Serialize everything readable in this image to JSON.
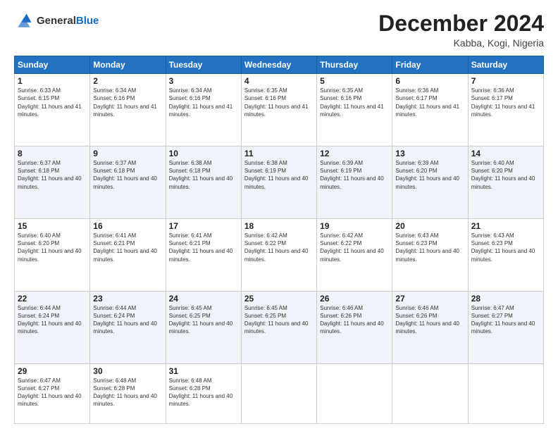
{
  "header": {
    "logo_general": "General",
    "logo_blue": "Blue",
    "month_title": "December 2024",
    "location": "Kabba, Kogi, Nigeria"
  },
  "weekdays": [
    "Sunday",
    "Monday",
    "Tuesday",
    "Wednesday",
    "Thursday",
    "Friday",
    "Saturday"
  ],
  "weeks": [
    [
      {
        "day": 1,
        "sunrise": "6:33 AM",
        "sunset": "6:15 PM",
        "daylight": "11 hours and 41 minutes."
      },
      {
        "day": 2,
        "sunrise": "6:34 AM",
        "sunset": "6:16 PM",
        "daylight": "11 hours and 41 minutes."
      },
      {
        "day": 3,
        "sunrise": "6:34 AM",
        "sunset": "6:16 PM",
        "daylight": "11 hours and 41 minutes."
      },
      {
        "day": 4,
        "sunrise": "6:35 AM",
        "sunset": "6:16 PM",
        "daylight": "11 hours and 41 minutes."
      },
      {
        "day": 5,
        "sunrise": "6:35 AM",
        "sunset": "6:16 PM",
        "daylight": "11 hours and 41 minutes."
      },
      {
        "day": 6,
        "sunrise": "6:36 AM",
        "sunset": "6:17 PM",
        "daylight": "11 hours and 41 minutes."
      },
      {
        "day": 7,
        "sunrise": "6:36 AM",
        "sunset": "6:17 PM",
        "daylight": "11 hours and 41 minutes."
      }
    ],
    [
      {
        "day": 8,
        "sunrise": "6:37 AM",
        "sunset": "6:18 PM",
        "daylight": "11 hours and 40 minutes."
      },
      {
        "day": 9,
        "sunrise": "6:37 AM",
        "sunset": "6:18 PM",
        "daylight": "11 hours and 40 minutes."
      },
      {
        "day": 10,
        "sunrise": "6:38 AM",
        "sunset": "6:18 PM",
        "daylight": "11 hours and 40 minutes."
      },
      {
        "day": 11,
        "sunrise": "6:38 AM",
        "sunset": "6:19 PM",
        "daylight": "11 hours and 40 minutes."
      },
      {
        "day": 12,
        "sunrise": "6:39 AM",
        "sunset": "6:19 PM",
        "daylight": "11 hours and 40 minutes."
      },
      {
        "day": 13,
        "sunrise": "6:39 AM",
        "sunset": "6:20 PM",
        "daylight": "11 hours and 40 minutes."
      },
      {
        "day": 14,
        "sunrise": "6:40 AM",
        "sunset": "6:20 PM",
        "daylight": "11 hours and 40 minutes."
      }
    ],
    [
      {
        "day": 15,
        "sunrise": "6:40 AM",
        "sunset": "6:20 PM",
        "daylight": "11 hours and 40 minutes."
      },
      {
        "day": 16,
        "sunrise": "6:41 AM",
        "sunset": "6:21 PM",
        "daylight": "11 hours and 40 minutes."
      },
      {
        "day": 17,
        "sunrise": "6:41 AM",
        "sunset": "6:21 PM",
        "daylight": "11 hours and 40 minutes."
      },
      {
        "day": 18,
        "sunrise": "6:42 AM",
        "sunset": "6:22 PM",
        "daylight": "11 hours and 40 minutes."
      },
      {
        "day": 19,
        "sunrise": "6:42 AM",
        "sunset": "6:22 PM",
        "daylight": "11 hours and 40 minutes."
      },
      {
        "day": 20,
        "sunrise": "6:43 AM",
        "sunset": "6:23 PM",
        "daylight": "11 hours and 40 minutes."
      },
      {
        "day": 21,
        "sunrise": "6:43 AM",
        "sunset": "6:23 PM",
        "daylight": "11 hours and 40 minutes."
      }
    ],
    [
      {
        "day": 22,
        "sunrise": "6:44 AM",
        "sunset": "6:24 PM",
        "daylight": "11 hours and 40 minutes."
      },
      {
        "day": 23,
        "sunrise": "6:44 AM",
        "sunset": "6:24 PM",
        "daylight": "11 hours and 40 minutes."
      },
      {
        "day": 24,
        "sunrise": "6:45 AM",
        "sunset": "6:25 PM",
        "daylight": "11 hours and 40 minutes."
      },
      {
        "day": 25,
        "sunrise": "6:45 AM",
        "sunset": "6:25 PM",
        "daylight": "11 hours and 40 minutes."
      },
      {
        "day": 26,
        "sunrise": "6:46 AM",
        "sunset": "6:26 PM",
        "daylight": "11 hours and 40 minutes."
      },
      {
        "day": 27,
        "sunrise": "6:46 AM",
        "sunset": "6:26 PM",
        "daylight": "11 hours and 40 minutes."
      },
      {
        "day": 28,
        "sunrise": "6:47 AM",
        "sunset": "6:27 PM",
        "daylight": "11 hours and 40 minutes."
      }
    ],
    [
      {
        "day": 29,
        "sunrise": "6:47 AM",
        "sunset": "6:27 PM",
        "daylight": "11 hours and 40 minutes."
      },
      {
        "day": 30,
        "sunrise": "6:48 AM",
        "sunset": "6:28 PM",
        "daylight": "11 hours and 40 minutes."
      },
      {
        "day": 31,
        "sunrise": "6:48 AM",
        "sunset": "6:28 PM",
        "daylight": "11 hours and 40 minutes."
      },
      null,
      null,
      null,
      null
    ]
  ]
}
